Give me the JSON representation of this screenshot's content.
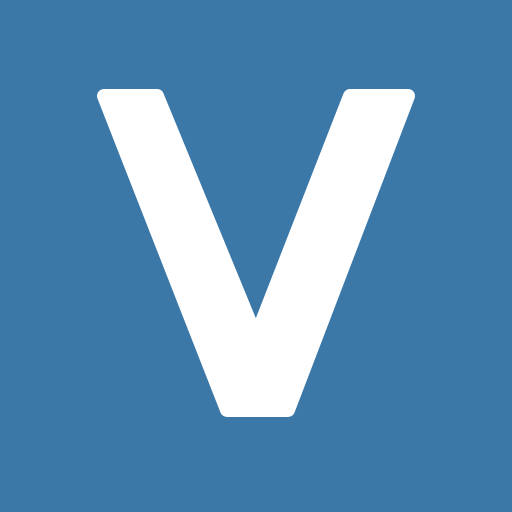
{
  "app_icon": {
    "name": "v-logo-icon",
    "background_color": "#3b78a8",
    "glyph_color": "#ffffff"
  }
}
